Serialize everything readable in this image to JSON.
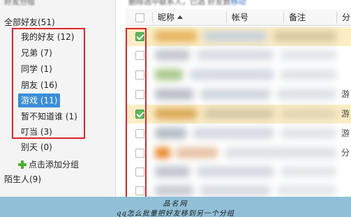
{
  "sidebar": {
    "header_label": "好友分组",
    "root_label": "全部好友(51)",
    "groups": [
      {
        "label": "我的好友 (12)",
        "selected": false
      },
      {
        "label": "兄弟 (7)",
        "selected": false
      },
      {
        "label": "同学 (1)",
        "selected": false
      },
      {
        "label": "朋友 (16)",
        "selected": false
      },
      {
        "label": "游戏 (11)",
        "selected": true
      },
      {
        "label": "暂不知道谁 (1)",
        "selected": false
      },
      {
        "label": "叮当 (3)",
        "selected": false
      }
    ],
    "other_group": "别天 (0)",
    "add_group_label": "点击添加分组",
    "strangers_label": "陌生人(9)"
  },
  "toolbar": {
    "blurred_text": "删除选中联系人，已选 好友数",
    "blurred_link": "移动"
  },
  "table": {
    "columns": [
      "昵称",
      "帐号",
      "备注",
      "分"
    ],
    "sort_column": "昵称",
    "sort_direction": "ascending",
    "rows": [
      {
        "checked": true,
        "highlighted": true,
        "tail": ""
      },
      {
        "checked": false,
        "highlighted": false,
        "tail": ""
      },
      {
        "checked": false,
        "highlighted": false,
        "tail": ""
      },
      {
        "checked": false,
        "highlighted": false,
        "tail": "游"
      },
      {
        "checked": true,
        "highlighted": true,
        "tail": "游"
      },
      {
        "checked": false,
        "highlighted": false,
        "tail": "游"
      },
      {
        "checked": false,
        "highlighted": false,
        "tail": "分"
      },
      {
        "checked": false,
        "highlighted": false,
        "tail": ""
      },
      {
        "checked": false,
        "highlighted": false,
        "tail": ""
      }
    ]
  },
  "watermark": {
    "line1": "品名网",
    "line2": "qq怎么批量把好友移到另一个分组"
  },
  "colors": {
    "selected_group": "#3a8ed8",
    "annotation_border": "#e0262b",
    "checkbox_checked": "#5cb85c",
    "highlighted_row": "#fbeec6",
    "banner": "#8fc0d8"
  }
}
